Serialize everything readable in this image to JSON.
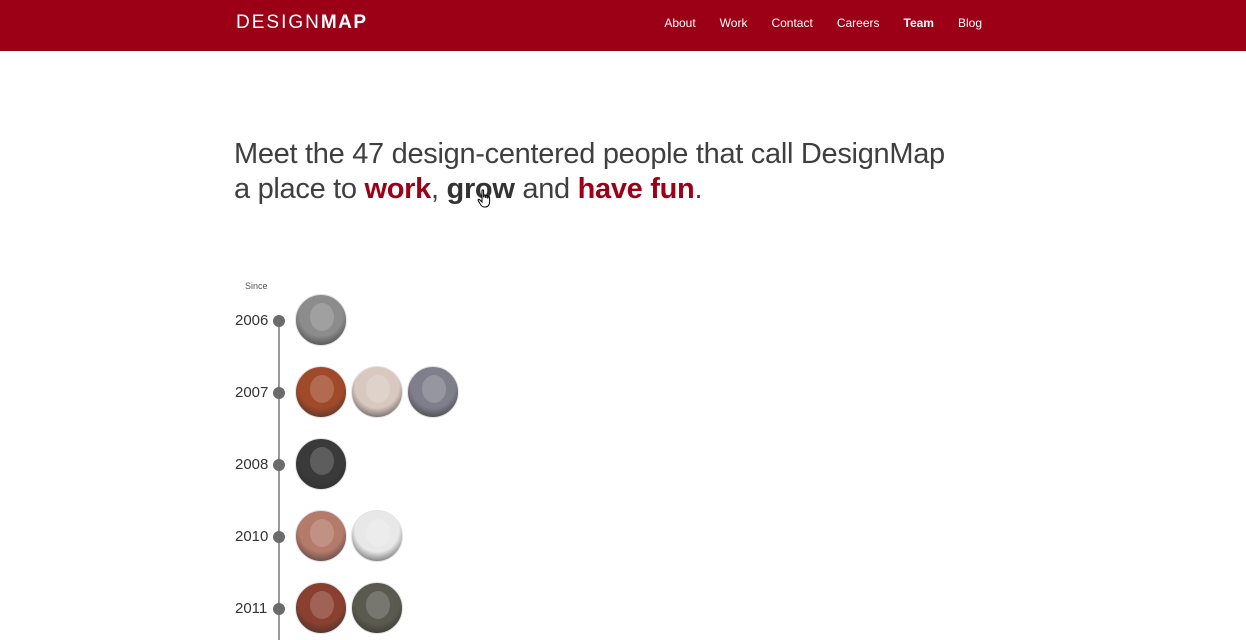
{
  "header": {
    "logo_light": "DESIGN",
    "logo_bold": "MAP",
    "nav": [
      {
        "label": "About",
        "active": false
      },
      {
        "label": "Work",
        "active": false
      },
      {
        "label": "Contact",
        "active": false
      },
      {
        "label": "Careers",
        "active": false
      },
      {
        "label": "Team",
        "active": true
      },
      {
        "label": "Blog",
        "active": false
      }
    ],
    "bar_color": "#9b0017"
  },
  "intro": {
    "line1": "Meet the 47 design-centered people that call DesignMap",
    "prefix": "a place to ",
    "word1": "work",
    "sep1": ", ",
    "word2": "grow",
    "sep2": " and ",
    "word3": "have fun",
    "end": "."
  },
  "timeline": {
    "since_label": "Since",
    "years": [
      {
        "year": "2006",
        "avatars": [
          "#8c8c8c"
        ]
      },
      {
        "year": "2007",
        "avatars": [
          "#a14a2a",
          "#d8c8c0",
          "#7e7f8a"
        ]
      },
      {
        "year": "2008",
        "avatars": [
          "#3a3a3a"
        ]
      },
      {
        "year": "2010",
        "avatars": [
          "#b47a6a",
          "#e8e8e8"
        ]
      },
      {
        "year": "2011",
        "avatars": [
          "#8a4030",
          "#5a5a50"
        ]
      }
    ]
  }
}
